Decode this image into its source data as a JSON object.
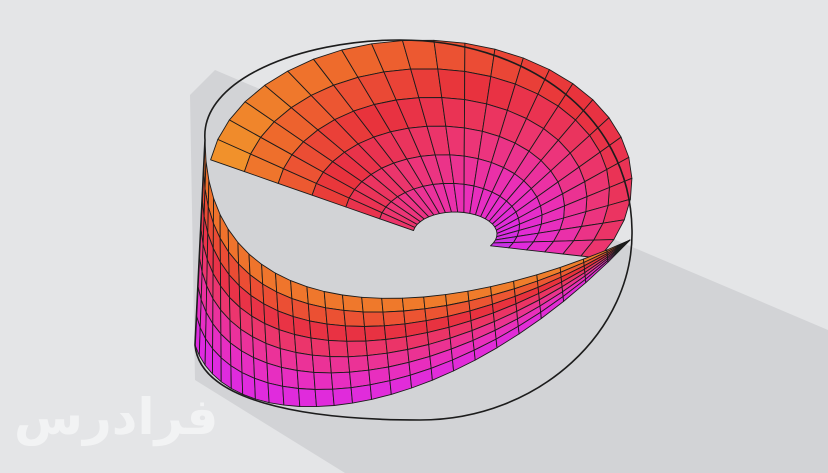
{
  "scene": {
    "subject": "mobius-strip",
    "background_color": "#e4e5e7",
    "shadow_color": "#d2d3d6",
    "edge_color": "#1c1c1c",
    "gradient_colors": [
      "#f2a22a",
      "#ee6a2c",
      "#e8323c",
      "#ec3574",
      "#ea2fb8",
      "#df2be0",
      "#a638ea"
    ],
    "watermark": "فرادرس"
  }
}
